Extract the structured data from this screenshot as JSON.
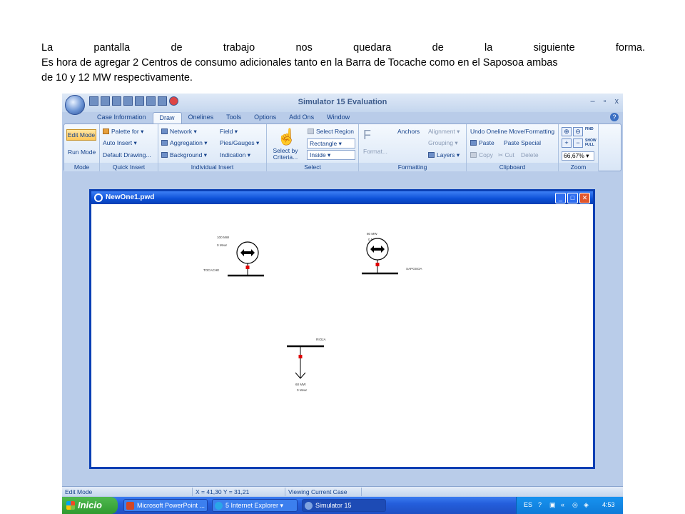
{
  "slide": {
    "line1_words": [
      "La",
      "pantalla",
      "de",
      "trabajo",
      "nos",
      "quedara",
      "de",
      "la",
      "siguiente",
      "forma."
    ],
    "line2": "Es hora de agregar 2 Centros de consumo adicionales tanto en la Barra de Tocache como en el  Saposoa ambas",
    "line3": "de 10 y  12 MW respectivamente."
  },
  "app": {
    "title": "Simulator 15 Evaluation",
    "window_controls": [
      "–",
      "▫",
      "x"
    ],
    "tabs": [
      "Case Information",
      "Draw",
      "Onelines",
      "Tools",
      "Options",
      "Add Ons",
      "Window"
    ],
    "active_tab": "Draw"
  },
  "ribbon": {
    "mode": {
      "edit": "Edit Mode",
      "run": "Run Mode",
      "label": "Mode"
    },
    "quick_insert": {
      "items": [
        "Palette for",
        "Auto Insert",
        "Default Drawing..."
      ],
      "label": "Quick Insert"
    },
    "individual_insert": {
      "col1": [
        "Network",
        "Aggregation",
        "Background"
      ],
      "col2": [
        "Field",
        "Pies/Gauges",
        "Indication"
      ],
      "label": "Individual Insert"
    },
    "select": {
      "by_criteria": "Select by Criteria...",
      "region": "Select Region",
      "shape": "Rectangle",
      "inside": "Inside",
      "label": "Select"
    },
    "formatting": {
      "format": "Format...",
      "anchors": "Anchors",
      "alignment": "Alignment",
      "grouping": "Grouping",
      "layers": "Layers",
      "label": "Formatting"
    },
    "clipboard": {
      "undo": "Undo Oneline Move/Formatting",
      "paste": "Paste",
      "paste_special": "Paste Special",
      "copy": "Copy",
      "cut": "Cut",
      "delete": "Delete",
      "label": "Clipboard"
    },
    "zoom": {
      "value": "66,67%",
      "label": "Zoom",
      "find": "FIND",
      "show_full": "SHOW FULL"
    }
  },
  "document": {
    "title": "NewOne1.pwd",
    "buses": [
      {
        "name": "TOCACHE",
        "gen_mw": "100 MW",
        "gen_mvar": "0 Mvar"
      },
      {
        "name": "SAPOSOA",
        "gen_mw": "80 MW",
        "gen_mvar": "0 Mvar"
      },
      {
        "name": "RIOJA",
        "load_mw": "60 MW",
        "load_mvar": "0 Mvar"
      }
    ]
  },
  "statusbar": {
    "mode": "Edit Mode",
    "coords": "X = 41,30 Y = 31,21",
    "view": "Viewing Current Case"
  },
  "taskbar": {
    "start": "Inicio",
    "tasks": [
      "Microsoft PowerPoint ...",
      "5 Internet Explorer",
      "Simulator 15"
    ],
    "lang": "ES",
    "time": "4:53"
  },
  "colors": {
    "accent": "#0a3fb4",
    "generator_dot": "#e00000",
    "ribbon": "#d9e6f6"
  }
}
